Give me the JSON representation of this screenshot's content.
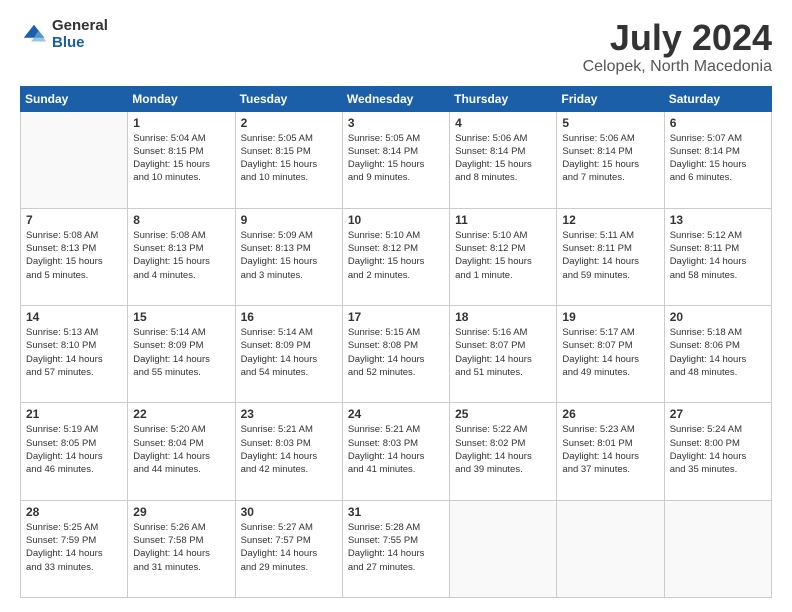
{
  "logo": {
    "general": "General",
    "blue": "Blue"
  },
  "header": {
    "title": "July 2024",
    "subtitle": "Celopek, North Macedonia"
  },
  "weekdays": [
    "Sunday",
    "Monday",
    "Tuesday",
    "Wednesday",
    "Thursday",
    "Friday",
    "Saturday"
  ],
  "weeks": [
    [
      {
        "day": "",
        "info": ""
      },
      {
        "day": "1",
        "info": "Sunrise: 5:04 AM\nSunset: 8:15 PM\nDaylight: 15 hours\nand 10 minutes."
      },
      {
        "day": "2",
        "info": "Sunrise: 5:05 AM\nSunset: 8:15 PM\nDaylight: 15 hours\nand 10 minutes."
      },
      {
        "day": "3",
        "info": "Sunrise: 5:05 AM\nSunset: 8:14 PM\nDaylight: 15 hours\nand 9 minutes."
      },
      {
        "day": "4",
        "info": "Sunrise: 5:06 AM\nSunset: 8:14 PM\nDaylight: 15 hours\nand 8 minutes."
      },
      {
        "day": "5",
        "info": "Sunrise: 5:06 AM\nSunset: 8:14 PM\nDaylight: 15 hours\nand 7 minutes."
      },
      {
        "day": "6",
        "info": "Sunrise: 5:07 AM\nSunset: 8:14 PM\nDaylight: 15 hours\nand 6 minutes."
      }
    ],
    [
      {
        "day": "7",
        "info": "Sunrise: 5:08 AM\nSunset: 8:13 PM\nDaylight: 15 hours\nand 5 minutes."
      },
      {
        "day": "8",
        "info": "Sunrise: 5:08 AM\nSunset: 8:13 PM\nDaylight: 15 hours\nand 4 minutes."
      },
      {
        "day": "9",
        "info": "Sunrise: 5:09 AM\nSunset: 8:13 PM\nDaylight: 15 hours\nand 3 minutes."
      },
      {
        "day": "10",
        "info": "Sunrise: 5:10 AM\nSunset: 8:12 PM\nDaylight: 15 hours\nand 2 minutes."
      },
      {
        "day": "11",
        "info": "Sunrise: 5:10 AM\nSunset: 8:12 PM\nDaylight: 15 hours\nand 1 minute."
      },
      {
        "day": "12",
        "info": "Sunrise: 5:11 AM\nSunset: 8:11 PM\nDaylight: 14 hours\nand 59 minutes."
      },
      {
        "day": "13",
        "info": "Sunrise: 5:12 AM\nSunset: 8:11 PM\nDaylight: 14 hours\nand 58 minutes."
      }
    ],
    [
      {
        "day": "14",
        "info": "Sunrise: 5:13 AM\nSunset: 8:10 PM\nDaylight: 14 hours\nand 57 minutes."
      },
      {
        "day": "15",
        "info": "Sunrise: 5:14 AM\nSunset: 8:09 PM\nDaylight: 14 hours\nand 55 minutes."
      },
      {
        "day": "16",
        "info": "Sunrise: 5:14 AM\nSunset: 8:09 PM\nDaylight: 14 hours\nand 54 minutes."
      },
      {
        "day": "17",
        "info": "Sunrise: 5:15 AM\nSunset: 8:08 PM\nDaylight: 14 hours\nand 52 minutes."
      },
      {
        "day": "18",
        "info": "Sunrise: 5:16 AM\nSunset: 8:07 PM\nDaylight: 14 hours\nand 51 minutes."
      },
      {
        "day": "19",
        "info": "Sunrise: 5:17 AM\nSunset: 8:07 PM\nDaylight: 14 hours\nand 49 minutes."
      },
      {
        "day": "20",
        "info": "Sunrise: 5:18 AM\nSunset: 8:06 PM\nDaylight: 14 hours\nand 48 minutes."
      }
    ],
    [
      {
        "day": "21",
        "info": "Sunrise: 5:19 AM\nSunset: 8:05 PM\nDaylight: 14 hours\nand 46 minutes."
      },
      {
        "day": "22",
        "info": "Sunrise: 5:20 AM\nSunset: 8:04 PM\nDaylight: 14 hours\nand 44 minutes."
      },
      {
        "day": "23",
        "info": "Sunrise: 5:21 AM\nSunset: 8:03 PM\nDaylight: 14 hours\nand 42 minutes."
      },
      {
        "day": "24",
        "info": "Sunrise: 5:21 AM\nSunset: 8:03 PM\nDaylight: 14 hours\nand 41 minutes."
      },
      {
        "day": "25",
        "info": "Sunrise: 5:22 AM\nSunset: 8:02 PM\nDaylight: 14 hours\nand 39 minutes."
      },
      {
        "day": "26",
        "info": "Sunrise: 5:23 AM\nSunset: 8:01 PM\nDaylight: 14 hours\nand 37 minutes."
      },
      {
        "day": "27",
        "info": "Sunrise: 5:24 AM\nSunset: 8:00 PM\nDaylight: 14 hours\nand 35 minutes."
      }
    ],
    [
      {
        "day": "28",
        "info": "Sunrise: 5:25 AM\nSunset: 7:59 PM\nDaylight: 14 hours\nand 33 minutes."
      },
      {
        "day": "29",
        "info": "Sunrise: 5:26 AM\nSunset: 7:58 PM\nDaylight: 14 hours\nand 31 minutes."
      },
      {
        "day": "30",
        "info": "Sunrise: 5:27 AM\nSunset: 7:57 PM\nDaylight: 14 hours\nand 29 minutes."
      },
      {
        "day": "31",
        "info": "Sunrise: 5:28 AM\nSunset: 7:55 PM\nDaylight: 14 hours\nand 27 minutes."
      },
      {
        "day": "",
        "info": ""
      },
      {
        "day": "",
        "info": ""
      },
      {
        "day": "",
        "info": ""
      }
    ]
  ]
}
